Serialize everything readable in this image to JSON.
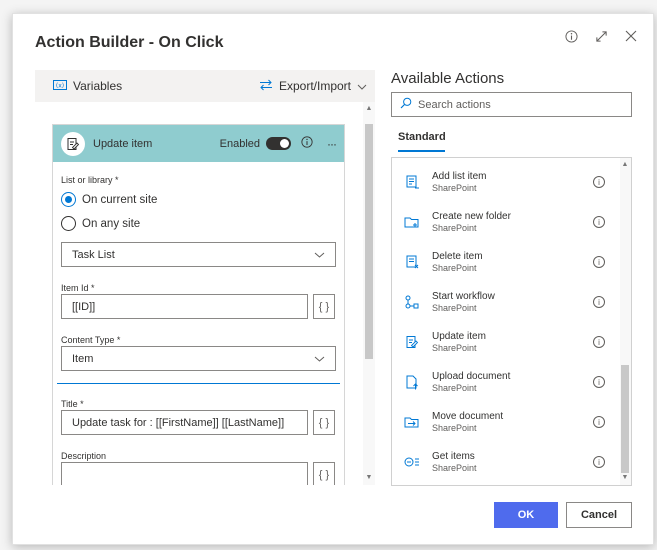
{
  "dialog": {
    "title": "Action Builder - On Click"
  },
  "toolbar": {
    "variables": "Variables",
    "export_import": "Export/Import"
  },
  "card": {
    "title": "Update item",
    "enabled_label": "Enabled",
    "more": "···",
    "list_label": "List or library *",
    "radio_current": "On current site",
    "radio_any": "On any site",
    "list_value": "Task List",
    "item_id_label": "Item Id *",
    "item_id_value": "[[ID]]",
    "content_type_label": "Content Type *",
    "content_type_value": "Item",
    "title_label": "Title *",
    "title_value": "Update task for : [[FirstName]] [[LastName]]",
    "description_label": "Description",
    "fx": "{ }"
  },
  "panel": {
    "title": "Available Actions",
    "search_placeholder": "Search actions",
    "tab": "Standard",
    "actions": [
      {
        "name": "Add list item",
        "source": "SharePoint"
      },
      {
        "name": "Create new folder",
        "source": "SharePoint"
      },
      {
        "name": "Delete item",
        "source": "SharePoint"
      },
      {
        "name": "Start workflow",
        "source": "SharePoint"
      },
      {
        "name": "Update item",
        "source": "SharePoint"
      },
      {
        "name": "Upload document",
        "source": "SharePoint"
      },
      {
        "name": "Move document",
        "source": "SharePoint"
      },
      {
        "name": "Get items",
        "source": "SharePoint"
      }
    ]
  },
  "buttons": {
    "ok": "OK",
    "cancel": "Cancel"
  },
  "colors": {
    "accent": "#0078d4",
    "ok_button": "#4f6bed",
    "card_header": "#8fcccf"
  }
}
